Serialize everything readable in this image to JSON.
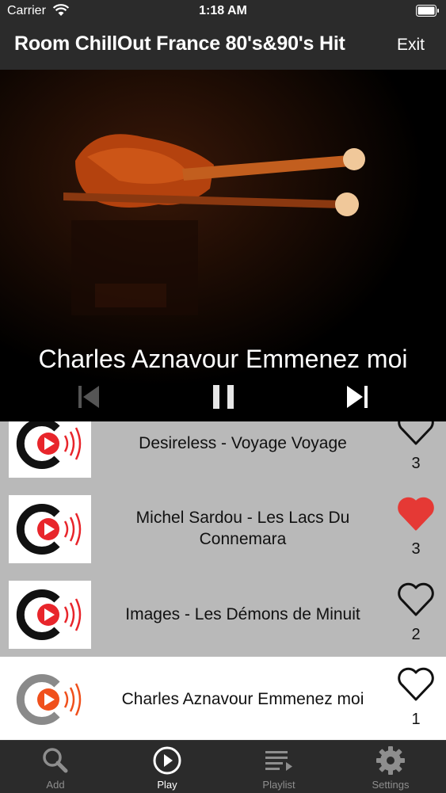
{
  "status": {
    "carrier": "Carrier",
    "time": "1:18 AM"
  },
  "header": {
    "title": "Room ChillOut France 80's&90's Hit",
    "exit_label": "Exit"
  },
  "player": {
    "now_playing": "Charles Aznavour Emmenez moi",
    "controls": [
      "previous-track",
      "pause",
      "next-track"
    ]
  },
  "playlist": [
    {
      "title": "Desireless - Voyage Voyage",
      "likes": "3",
      "liked": false,
      "active": false
    },
    {
      "title": "Michel Sardou - Les Lacs Du Connemara",
      "likes": "3",
      "liked": true,
      "active": false
    },
    {
      "title": "Images - Les Démons de Minuit",
      "likes": "2",
      "liked": false,
      "active": false
    },
    {
      "title": "Charles Aznavour Emmenez moi",
      "likes": "1",
      "liked": false,
      "active": true
    }
  ],
  "tabs": [
    {
      "label": "Add",
      "icon": "search-icon",
      "active": false
    },
    {
      "label": "Play",
      "icon": "play-circle-icon",
      "active": true
    },
    {
      "label": "Playlist",
      "icon": "playlist-icon",
      "active": false
    },
    {
      "label": "Settings",
      "icon": "gear-icon",
      "active": false
    }
  ],
  "colors": {
    "bar": "#2b2b2b",
    "list_bg": "#b9b9b9",
    "heart_filled": "#e53935",
    "logo_red": "#e8252b"
  }
}
